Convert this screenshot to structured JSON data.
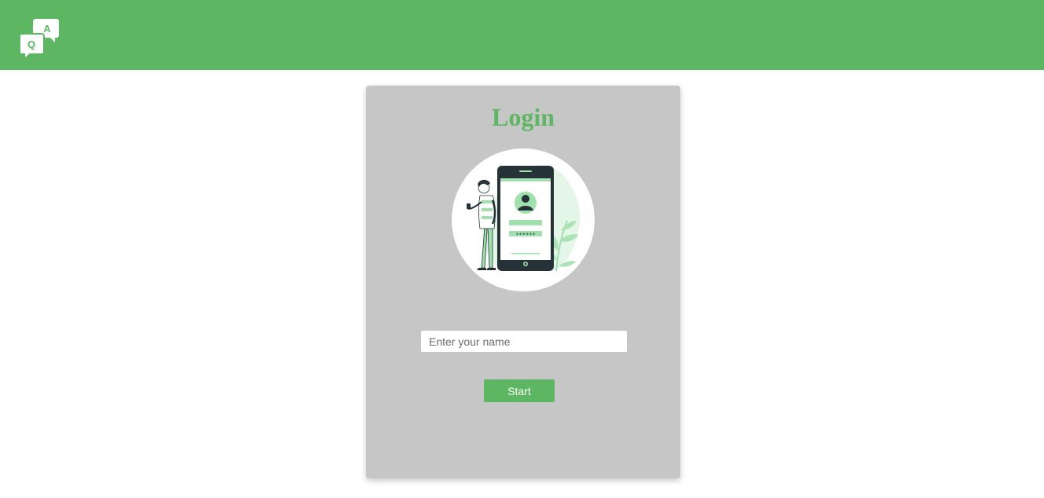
{
  "header": {
    "logo": {
      "icon": "qa-chat-bubbles-icon",
      "letter_q": "Q",
      "letter_a": "A"
    }
  },
  "login": {
    "title": "Login",
    "illustration": {
      "icon": "mobile-login-illustration",
      "password_mask": "******"
    },
    "name_input": {
      "placeholder": "Enter your name",
      "value": ""
    },
    "start_label": "Start"
  },
  "colors": {
    "brand_green": "#5db762",
    "card_background": "#c6c6c6",
    "page_background": "#ffffff"
  }
}
